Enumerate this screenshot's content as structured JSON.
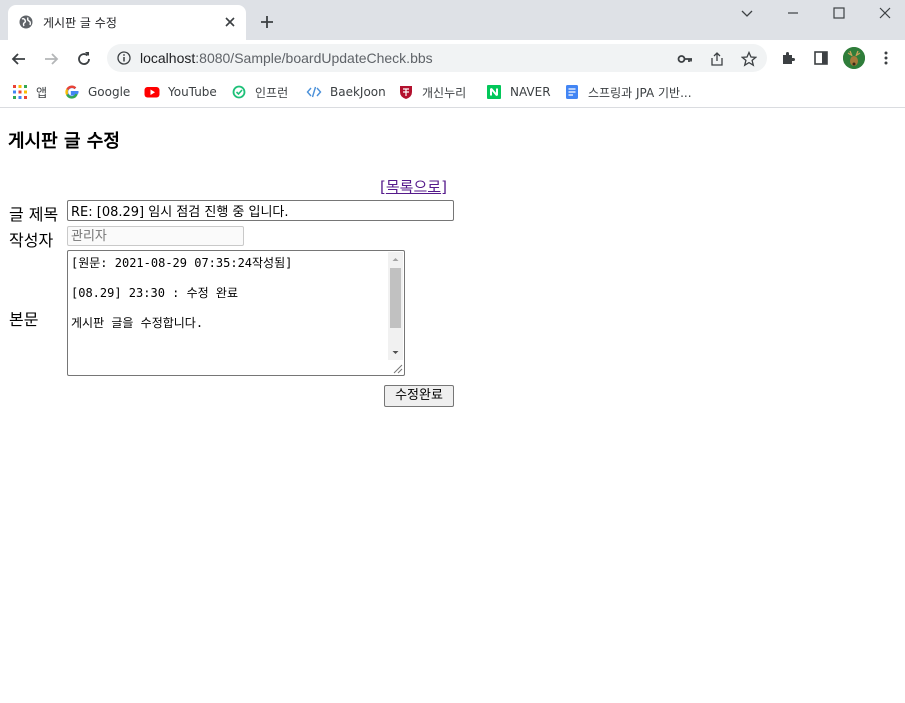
{
  "browser": {
    "tab_title": "게시판 글 수정",
    "url_host": "localhost",
    "url_path": ":8080/Sample/boardUpdateCheck.bbs",
    "bookmarks": [
      {
        "label": "앱",
        "icon": "apps-grid-icon"
      },
      {
        "label": "Google",
        "icon": "google-icon"
      },
      {
        "label": "YouTube",
        "icon": "youtube-icon"
      },
      {
        "label": "인프런",
        "icon": "inflearn-icon"
      },
      {
        "label": "BaekJoon",
        "icon": "code-icon"
      },
      {
        "label": "개신누리",
        "icon": "shield-crest-icon"
      },
      {
        "label": "NAVER",
        "icon": "naver-icon"
      },
      {
        "label": "스프링과 JPA 기반...",
        "icon": "docs-icon"
      }
    ]
  },
  "page": {
    "heading": "게시판 글 수정",
    "list_link_open": "[",
    "list_link_text": "목록으로",
    "list_link_close": "]",
    "title_label": "글 제목",
    "title_value": "RE: [08.29] 임시 점검 진행 중 입니다.",
    "writer_label": "작성자",
    "writer_placeholder": "관리자",
    "content_label": "본문",
    "content_value": "[원문: 2021-08-29 07:35:24작성됨]\n\n[08.29] 23:30 : 수정 완료\n\n게시판 글을 수정합니다.",
    "submit_label": "수정완료"
  },
  "colors": {
    "chrome_bg": "#dee1e6",
    "visited_link": "#551a8b",
    "omnibox_bg": "#f1f3f4"
  }
}
